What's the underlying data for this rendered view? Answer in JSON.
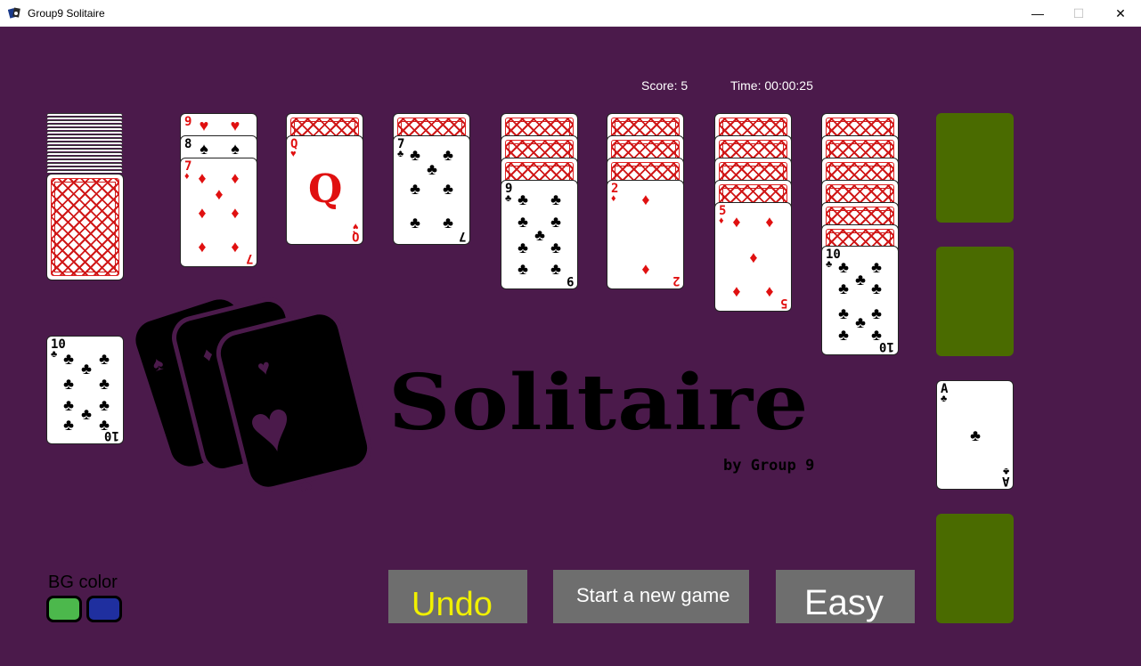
{
  "window": {
    "title": "Group9 Solitaire",
    "min": "—",
    "max": "☐",
    "close": "✕"
  },
  "status": {
    "score": "Score: 5",
    "time": "Time: 00:00:25"
  },
  "logo": {
    "title": "Solitaire",
    "byline": "by Group 9"
  },
  "controls": {
    "bg_color_label": "BG color",
    "undo": "Undo",
    "new_game": "Start a new game",
    "difficulty": "Easy"
  },
  "colors": {
    "board": "#4b1a4b",
    "foundation_slot": "#4a6b00",
    "button": "#6e6e6e",
    "undo_text": "#f0f000"
  },
  "waste_card": {
    "rank": "10",
    "suit": "♣"
  },
  "tableau": [
    {
      "peek": [
        {
          "rank": "9",
          "suit": "♥"
        },
        {
          "rank": "8",
          "suit": "♠"
        }
      ],
      "top": {
        "rank": "7",
        "suit": "♦"
      }
    },
    {
      "hidden": 1,
      "top": {
        "rank": "Q",
        "suit": "♥"
      }
    },
    {
      "hidden": 1,
      "top": {
        "rank": "7",
        "suit": "♣"
      }
    },
    {
      "hidden": 3,
      "top": {
        "rank": "9",
        "suit": "♣"
      }
    },
    {
      "hidden": 3,
      "top": {
        "rank": "2",
        "suit": "♦"
      }
    },
    {
      "hidden": 4,
      "top": {
        "rank": "5",
        "suit": "♦"
      }
    },
    {
      "hidden": 6,
      "top": {
        "rank": "10",
        "suit": "♣"
      }
    }
  ],
  "foundations": [
    null,
    null,
    {
      "rank": "A",
      "suit": "♣"
    },
    null
  ]
}
